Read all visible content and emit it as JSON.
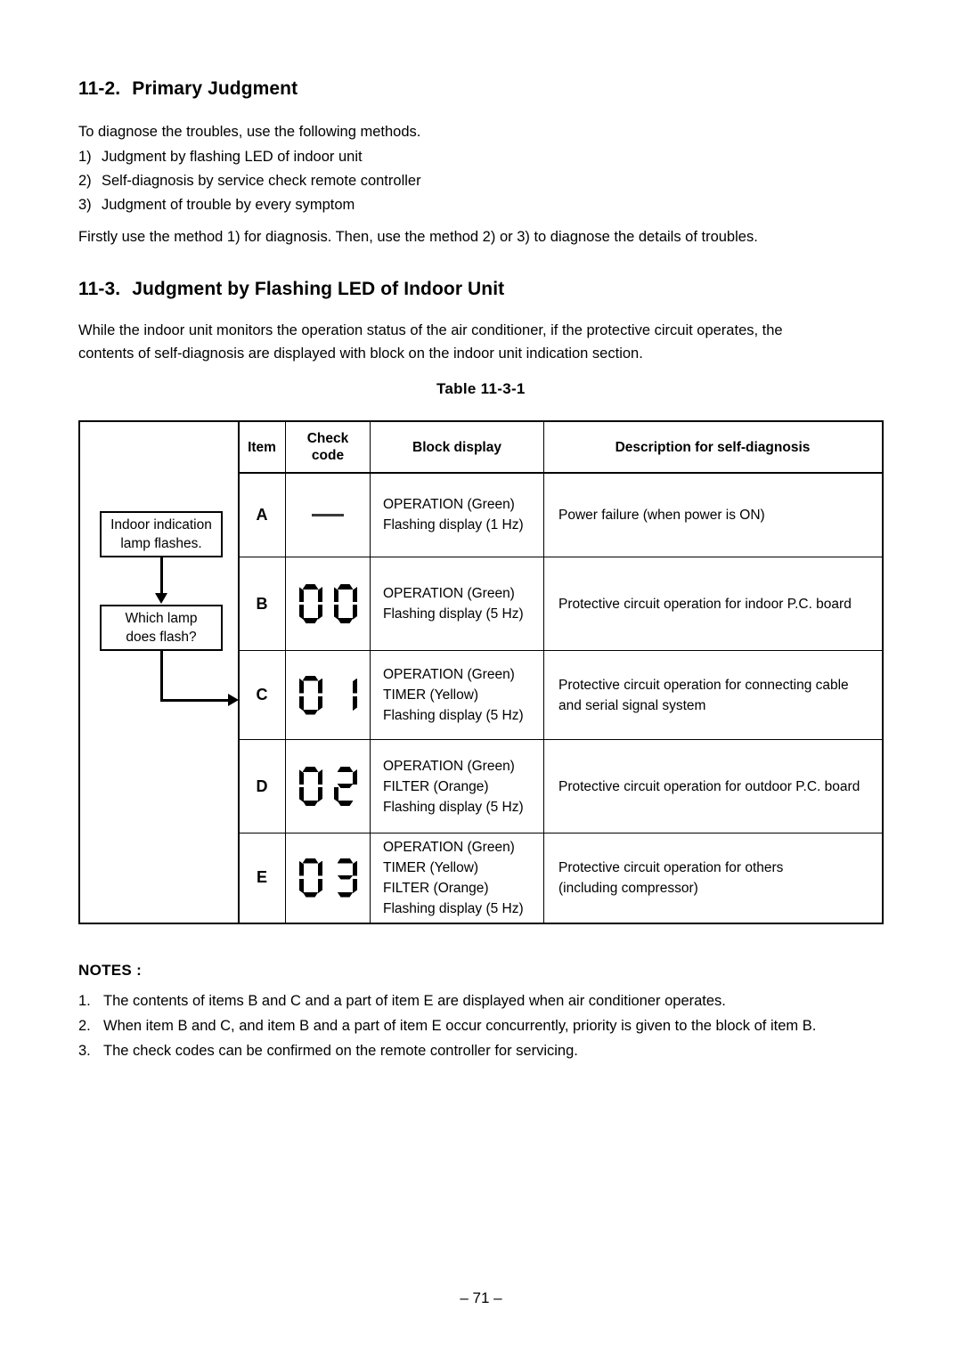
{
  "sections": [
    {
      "number": "11-2.",
      "title": "Primary Judgment",
      "intro": "To diagnose the troubles, use the following methods.",
      "methods": [
        {
          "marker": "1)",
          "text": "Judgment by flashing LED of indoor unit"
        },
        {
          "marker": "2)",
          "text": "Self-diagnosis by service check remote controller"
        },
        {
          "marker": "3)",
          "text": "Judgment of trouble by every symptom"
        }
      ],
      "closing": "Firstly use the method 1) for diagnosis. Then, use the method 2) or 3) to diagnose the details of troubles."
    },
    {
      "number": "11-3.",
      "title": "Judgment by Flashing LED of Indoor Unit",
      "paragraph_line1": "While the indoor unit monitors the operation status of the air conditioner, if the protective circuit operates, the",
      "paragraph_line2": "contents of self-diagnosis are displayed with block on the indoor unit indication section."
    }
  ],
  "table": {
    "caption": "Table 11-3-1",
    "headers": {
      "flow": "",
      "item": "Item",
      "check_code_line1": "Check",
      "check_code_line2": "code",
      "block_display": "Block display",
      "description": "Description for self-diagnosis"
    },
    "flowchart": {
      "box1_line1": "Indoor indication",
      "box1_line2": "lamp flashes.",
      "box2_line1": "Which lamp",
      "box2_line2": "does flash?"
    },
    "rows": [
      {
        "item": "A",
        "check_code": "—",
        "check_code_type": "dash",
        "block_display": [
          "OPERATION (Green)",
          "Flashing display (1 Hz)"
        ],
        "description": [
          "Power failure (when power is ON)"
        ]
      },
      {
        "item": "B",
        "check_code": "00",
        "check_code_type": "seven-segment",
        "block_display": [
          "OPERATION (Green)",
          "Flashing display (5 Hz)"
        ],
        "description": [
          "Protective circuit operation for indoor P.C. board"
        ]
      },
      {
        "item": "C",
        "check_code": "01",
        "check_code_type": "seven-segment",
        "block_display": [
          "OPERATION (Green)",
          "TIMER (Yellow)",
          "Flashing display (5 Hz)"
        ],
        "description": [
          "Protective circuit operation for connecting cable",
          "and serial signal system"
        ]
      },
      {
        "item": "D",
        "check_code": "02",
        "check_code_type": "seven-segment",
        "block_display": [
          "OPERATION (Green)",
          "FILTER (Orange)",
          "Flashing display (5 Hz)"
        ],
        "description": [
          "Protective circuit operation for outdoor P.C. board"
        ]
      },
      {
        "item": "E",
        "check_code": "03",
        "check_code_type": "seven-segment",
        "block_display": [
          "OPERATION (Green)",
          "TIMER (Yellow)",
          "FILTER (Orange)",
          "Flashing display (5 Hz)"
        ],
        "description": [
          "Protective circuit operation for others",
          "(including compressor)"
        ]
      }
    ]
  },
  "notes": {
    "title": "NOTES :",
    "items": [
      {
        "marker": "1.",
        "text": "The contents of items B and C and a part of item E are displayed when air conditioner operates."
      },
      {
        "marker": "2.",
        "text": "When item B and C, and item B and a part of item E occur concurrently, priority is given to the block of item B."
      },
      {
        "marker": "3.",
        "text": "The check codes can be confirmed on the remote controller for servicing."
      }
    ]
  },
  "footer": {
    "page_number": "– 71 –"
  }
}
